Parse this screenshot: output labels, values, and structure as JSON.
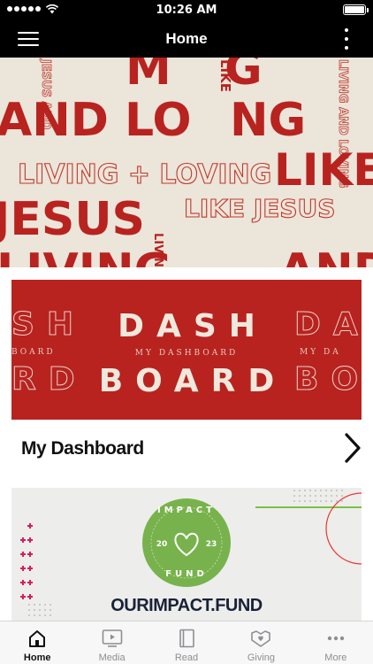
{
  "status_bar": {
    "time": "10:26 AM",
    "signal_icon": "signal-dots-icon",
    "wifi_icon": "wifi-icon",
    "battery_icon": "battery-icon",
    "battery_level": 1.0
  },
  "nav": {
    "title": "Home",
    "menu_icon": "hamburger-menu-icon",
    "more_icon": "vertical-ellipsis-icon"
  },
  "hero": {
    "text_fragments": [
      "AND LO",
      "NG",
      "M",
      "G",
      "LIKE",
      "LIVING + LOVING",
      "LIKE JESUS",
      "JESUS",
      "LIKE JESUS",
      "LIVING",
      "AND",
      "LIVING AND LOVING",
      "JESUS AND",
      "LIVING AND LOVING"
    ],
    "colors": {
      "background": "#ebe5da",
      "accent": "#b8231f"
    }
  },
  "dashboard": {
    "graphic_rows": [
      "DASH",
      "MY DASHBOARD",
      "BOARD"
    ],
    "graphic_ghost": [
      "SH",
      "DA",
      "BOARD",
      "MY DA",
      "RD",
      "BO"
    ],
    "label": "My Dashboard",
    "chevron_icon": "chevron-right-icon",
    "colors": {
      "card": "#b8231f",
      "lettering": "#efe8dc"
    }
  },
  "impact": {
    "badge_text_top": "IMPACT",
    "badge_year_left": "20",
    "badge_year_right": "23",
    "badge_text_bottom": "FUND",
    "wordmark": "OURIMPACT.FUND",
    "colors": {
      "badge": "#78b24c",
      "plus": "#d81b60",
      "line_green": "#7bc043",
      "line_red": "#e53935"
    }
  },
  "tabs": [
    {
      "label": "Home",
      "icon": "home-icon",
      "active": true
    },
    {
      "label": "Media",
      "icon": "tv-play-icon",
      "active": false
    },
    {
      "label": "Read",
      "icon": "book-icon",
      "active": false
    },
    {
      "label": "Giving",
      "icon": "handshake-heart-icon",
      "active": false
    },
    {
      "label": "More",
      "icon": "more-dots-icon",
      "active": false
    }
  ]
}
